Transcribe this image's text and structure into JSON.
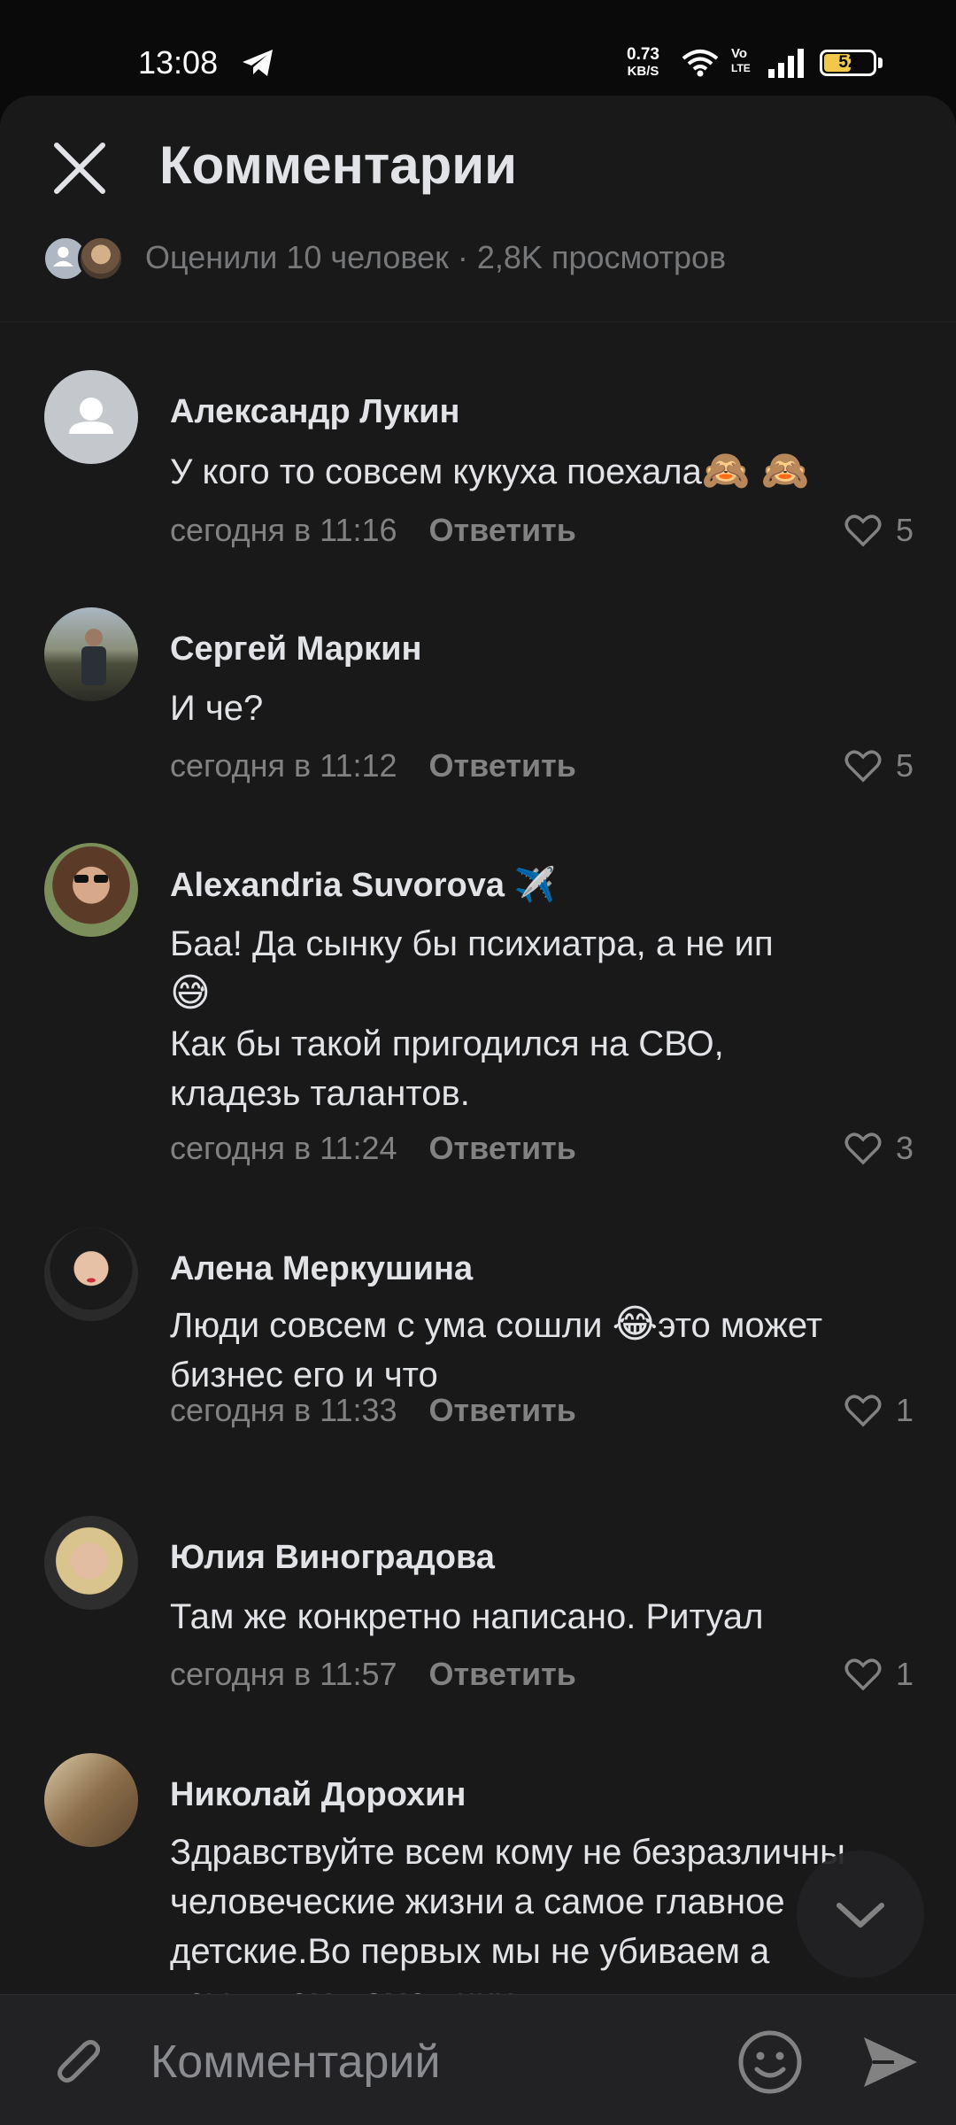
{
  "status_bar": {
    "time": "13:08",
    "net_speed_value": "0.73",
    "net_speed_unit": "KB/S",
    "volte_top": "Vo",
    "volte_bottom": "LTE",
    "battery_level": "52"
  },
  "header": {
    "title": "Комментарии",
    "stats": "Оценили 10 человек · 2,8K просмотров"
  },
  "comments": [
    {
      "author": "Александр Лукин",
      "text": "У кого то совсем кукуха поехала",
      "emoji": "🙈 🙈",
      "time": "сегодня в 11:16",
      "reply": "Ответить",
      "likes": "5"
    },
    {
      "author": "Сергей Маркин",
      "text": "И че?",
      "time": "сегодня в 11:12",
      "reply": "Ответить",
      "likes": "5"
    },
    {
      "author": "Alexandria Suvorova",
      "author_emoji": "✈️",
      "text_line1": "Баа! Да сынку  бы психиатра, а не ип",
      "emoji": "😅",
      "text_line2": "Как бы такой пригодился на СВО, кладезь талантов.",
      "time": "сегодня в 11:24",
      "reply": "Ответить",
      "likes": "3"
    },
    {
      "author": "Алена Меркушина",
      "text_before": "Люди совсем с ума сошли ",
      "emoji": "😂",
      "text_after": "это может бизнес его и что",
      "time": "сегодня в 11:33",
      "reply": "Ответить",
      "likes": "1"
    },
    {
      "author": "Юлия Виноградова",
      "text": "Там же конкретно написано. Ритуал",
      "time": "сегодня в 11:57",
      "reply": "Ответить",
      "likes": "1"
    },
    {
      "author": "Николай Дорохин",
      "text": "Здравствуйте всем кому не безразличны человеческие жизни а самое главное детские.Во первых мы не убиваем а усыпляем домашних"
    }
  ],
  "composer": {
    "placeholder": "Комментарий"
  },
  "icons": {
    "close": "close-icon",
    "attach": "paperclip-icon",
    "emoji": "smile-icon",
    "send": "send-icon",
    "scroll": "chevron-down-icon",
    "like": "heart-icon"
  },
  "colors": {
    "background": "#19191a",
    "text_primary": "#e1e3e6",
    "text_secondary": "#828282",
    "battery_fill": "#f2c84b"
  }
}
